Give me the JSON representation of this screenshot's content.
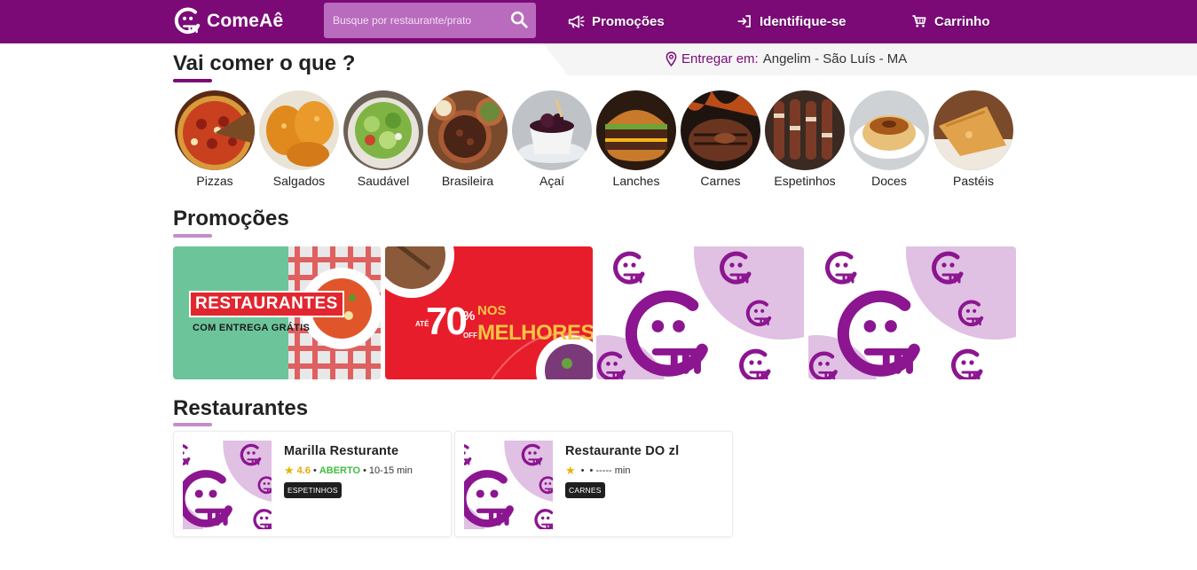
{
  "header": {
    "brand": "ComeAê",
    "search_placeholder": "Busque por restaurante/prato",
    "nav": [
      {
        "label": "Promoções",
        "icon": "megaphone-icon"
      },
      {
        "label": "Identifique-se",
        "icon": "sign-in-icon"
      },
      {
        "label": "Carrinho",
        "icon": "cart-icon"
      }
    ]
  },
  "location": {
    "label": "Entregar em:",
    "value": "Angelim - São Luís - MA",
    "icon": "map-pin-icon"
  },
  "sections": {
    "categories_title": "Vai comer o que ?",
    "promotions_title": "Promoções",
    "restaurants_title": "Restaurantes"
  },
  "categories": [
    {
      "label": "Pizzas"
    },
    {
      "label": "Salgados"
    },
    {
      "label": "Saudável"
    },
    {
      "label": "Brasileira"
    },
    {
      "label": "Açaí"
    },
    {
      "label": "Lanches"
    },
    {
      "label": "Carnes"
    },
    {
      "label": "Espetinhos"
    },
    {
      "label": "Doces"
    },
    {
      "label": "Pastéis"
    }
  ],
  "promotions": [
    {
      "line1": "RESTAURANTES",
      "line2": "COM ENTREGA GRÁTIS"
    },
    {
      "prefix": "ATÉ",
      "big": "70",
      "pct": "%",
      "off": "OFF",
      "line1": "NOS",
      "line2": "MELHORES"
    },
    {
      "kind": "logo-pattern"
    },
    {
      "kind": "logo-pattern"
    }
  ],
  "restaurants": [
    {
      "name": "Marilla Resturante",
      "star": "★",
      "rating": "4.6",
      "sep1": "•",
      "status": "ABERTO",
      "sep2": "•",
      "time": "10-15 min",
      "tag": "ESPETINHOS"
    },
    {
      "name": "Restaurante DO zl",
      "star": "★",
      "rating": "",
      "sep1": "•",
      "status": "",
      "sep2": "•",
      "time": "----- min",
      "tag": "CARNES"
    }
  ],
  "colors": {
    "brand": "#7b0a77",
    "underline_primary": "#7b0a77",
    "underline_light": "#c58ccb",
    "open": "#3fbd3f",
    "star": "#e6b400"
  }
}
